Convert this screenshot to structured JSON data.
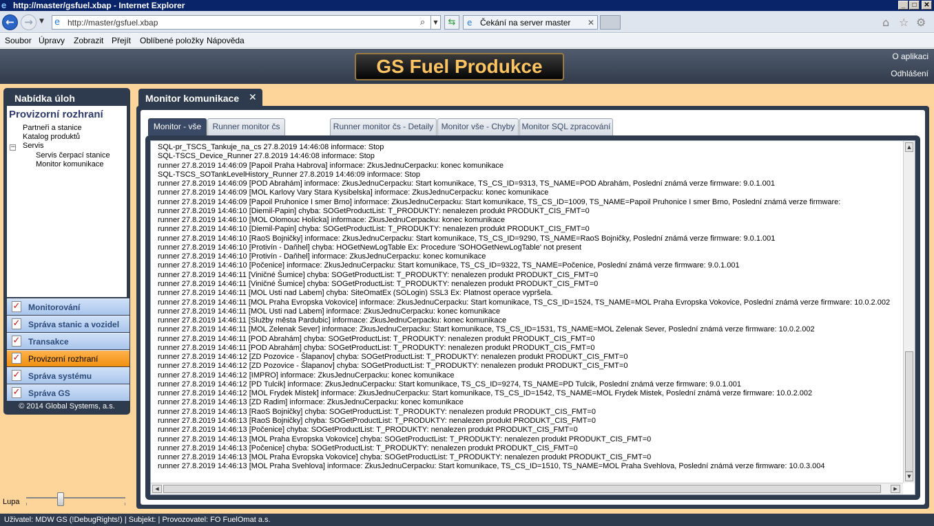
{
  "window": {
    "title": "http://master/gsfuel.xbap - Internet Explorer",
    "minimize": "_",
    "maximize": "□",
    "close": "✕"
  },
  "browser": {
    "url": "http://master/gsfuel.xbap",
    "tab_title": "Čekání na server master"
  },
  "menu": [
    "Soubor",
    "Úpravy",
    "Zobrazit",
    "Přejít",
    "Oblíbené položky",
    "Nápověda"
  ],
  "app": {
    "title": "GS Fuel Produkce",
    "about_link": "O aplikaci",
    "logout_link": "Odhlášení"
  },
  "left_panel": {
    "title": "Nabídka úloh",
    "tree_title": "Provizorní rozhraní",
    "tree": {
      "item1": "Partneři a stanice",
      "item2": "Katalog produktů",
      "group": "Servis",
      "toggle": "−",
      "sub1": "Servis čerpací stanice",
      "sub2": "Monitor komunikace"
    },
    "nav": [
      {
        "label": "Monitorování"
      },
      {
        "label": "Správa stanic a vozidel"
      },
      {
        "label": "Transakce"
      },
      {
        "label": "Provizorní rozhraní"
      },
      {
        "label": "Správa systému"
      },
      {
        "label": "Správa GS"
      }
    ],
    "copyright": "© 2014 Global Systems, a.s.",
    "zoom_label": "Lupa"
  },
  "main": {
    "tab_title": "Monitor komunikace",
    "tab_close": "✕",
    "subtabs": [
      "Monitor - vše",
      "Runner monitor čs",
      "Runner monitor čs - Detaily",
      "Monitor vše - Chyby",
      "Monitor SQL zpracování"
    ],
    "log": [
      "SQL-pr_TSCS_Tankuje_na_cs 27.8.2019 14:46:08 informace: Stop",
      "SQL-TSCS_Device_Runner 27.8.2019 14:46:08 informace: Stop",
      "runner 27.8.2019 14:46:09 [Papoil Praha Habrova] informace: ZkusJednuCerpacku: konec komunikace",
      "SQL-TSCS_SOTankLevelHistory_Runner 27.8.2019 14:46:09 informace: Stop",
      "runner 27.8.2019 14:46:09 [POD Abrahám] informace: ZkusJednuCerpacku: Start komunikace, TS_CS_ID=9313, TS_NAME=POD Abrahám, Poslední známá verze firmware: 9.0.1.001",
      "runner 27.8.2019 14:46:09 [MOL Karlovy Vary Stara Kysibelska] informace: ZkusJednuCerpacku: konec komunikace",
      "runner 27.8.2019 14:46:09 [Papoil Pruhonice I smer Brno] informace: ZkusJednuCerpacku: Start komunikace, TS_CS_ID=1009, TS_NAME=Papoil Pruhonice I smer Brno, Poslední známá verze firmware:",
      "runner 27.8.2019 14:46:10 [Diemil-Papin] chyba: SOGetProductList: T_PRODUKTY: nenalezen produkt PRODUKT_CIS_FMT=0",
      "runner 27.8.2019 14:46:10 [MOL Olomouc Holicka] informace: ZkusJednuCerpacku: konec komunikace",
      "runner 27.8.2019 14:46:10 [Diemil-Papin] chyba: SOGetProductList: T_PRODUKTY: nenalezen produkt PRODUKT_CIS_FMT=0",
      "runner 27.8.2019 14:46:10 [RaoS Bojničky] informace: ZkusJednuCerpacku: Start komunikace, TS_CS_ID=9290, TS_NAME=RaoS Bojničky, Poslední známá verze firmware: 9.0.1.001",
      "runner 27.8.2019 14:46:10 [Protivín - Daňhel] chyba: HOGetNewLogTable Ex: Procedure 'SOHOGetNewLogTable' not present",
      "runner 27.8.2019 14:46:10 [Protivín - Daňhel] informace: ZkusJednuCerpacku: konec komunikace",
      "runner 27.8.2019 14:46:10 [Počenice] informace: ZkusJednuCerpacku: Start komunikace, TS_CS_ID=9322, TS_NAME=Počenice, Poslední známá verze firmware: 9.0.1.001",
      "runner 27.8.2019 14:46:11 [Viničné Šumice] chyba: SOGetProductList: T_PRODUKTY: nenalezen produkt PRODUKT_CIS_FMT=0",
      "runner 27.8.2019 14:46:11 [Viničné Šumice] chyba: SOGetProductList: T_PRODUKTY: nenalezen produkt PRODUKT_CIS_FMT=0",
      "runner 27.8.2019 14:46:11 [MOL Usti nad Labem] chyba: SiteOmatEx (SOLogin) SSL3 Ex: Platnost operace vypršela.",
      "runner 27.8.2019 14:46:11 [MOL Praha Evropska Vokovice] informace: ZkusJednuCerpacku: Start komunikace, TS_CS_ID=1524, TS_NAME=MOL Praha Evropska Vokovice, Poslední známá verze firmware: 10.0.2.002",
      "runner 27.8.2019 14:46:11 [MOL Usti nad Labem] informace: ZkusJednuCerpacku: konec komunikace",
      "runner 27.8.2019 14:46:11 [Služby města Pardubic] informace: ZkusJednuCerpacku: konec komunikace",
      "runner 27.8.2019 14:46:11 [MOL Zelenak Sever] informace: ZkusJednuCerpacku: Start komunikace, TS_CS_ID=1531, TS_NAME=MOL Zelenak Sever, Poslední známá verze firmware: 10.0.2.002",
      "runner 27.8.2019 14:46:11 [POD Abrahám] chyba: SOGetProductList: T_PRODUKTY: nenalezen produkt PRODUKT_CIS_FMT=0",
      "runner 27.8.2019 14:46:11 [POD Abrahám] chyba: SOGetProductList: T_PRODUKTY: nenalezen produkt PRODUKT_CIS_FMT=0",
      "runner 27.8.2019 14:46:12 [ZD Pozovice - Šlapanov] chyba: SOGetProductList: T_PRODUKTY: nenalezen produkt PRODUKT_CIS_FMT=0",
      "runner 27.8.2019 14:46:12 [ZD Pozovice - Šlapanov] chyba: SOGetProductList: T_PRODUKTY: nenalezen produkt PRODUKT_CIS_FMT=0",
      "runner 27.8.2019 14:46:12 [IMPRO] informace: ZkusJednuCerpacku: konec komunikace",
      "runner 27.8.2019 14:46:12 [PD Tulcik] informace: ZkusJednuCerpacku: Start komunikace, TS_CS_ID=9274, TS_NAME=PD Tulcik, Poslední známá verze firmware: 9.0.1.001",
      "runner 27.8.2019 14:46:12 [MOL Frydek Mistek] informace: ZkusJednuCerpacku: Start komunikace, TS_CS_ID=1542, TS_NAME=MOL Frydek Mistek, Poslední známá verze firmware: 10.0.2.002",
      "runner 27.8.2019 14:46:13 [ZD Radim] informace: ZkusJednuCerpacku: konec komunikace",
      "runner 27.8.2019 14:46:13 [RaoS Bojničky] chyba: SOGetProductList: T_PRODUKTY: nenalezen produkt PRODUKT_CIS_FMT=0",
      "runner 27.8.2019 14:46:13 [RaoS Bojničky] chyba: SOGetProductList: T_PRODUKTY: nenalezen produkt PRODUKT_CIS_FMT=0",
      "runner 27.8.2019 14:46:13 [Počenice] chyba: SOGetProductList: T_PRODUKTY: nenalezen produkt PRODUKT_CIS_FMT=0",
      "runner 27.8.2019 14:46:13 [MOL Praha Evropska Vokovice] chyba: SOGetProductList: T_PRODUKTY: nenalezen produkt PRODUKT_CIS_FMT=0",
      "runner 27.8.2019 14:46:13 [Počenice] chyba: SOGetProductList: T_PRODUKTY: nenalezen produkt PRODUKT_CIS_FMT=0",
      "runner 27.8.2019 14:46:13 [MOL Praha Evropska Vokovice] chyba: SOGetProductList: T_PRODUKTY: nenalezen produkt PRODUKT_CIS_FMT=0",
      "runner 27.8.2019 14:46:13 [MOL Praha Svehlova] informace: ZkusJednuCerpacku: Start komunikace, TS_CS_ID=1510, TS_NAME=MOL Praha Svehlova, Poslední známá verze firmware: 10.0.3.004"
    ]
  },
  "status": "Uživatel: MDW GS (!DebugRights!) | Subjekt:   | Provozovatel: FO FuelOmat a.s.",
  "icons": {
    "ie": "ie-logo-icon",
    "back": "back-arrow-icon",
    "forward": "forward-arrow-icon",
    "search": "search-icon",
    "refresh": "refresh-icon",
    "home": "home-icon",
    "favorites": "star-icon",
    "tools": "gear-icon",
    "checklist": "checklist-icon"
  },
  "colors": {
    "app_background": "#fdd49a",
    "panel_dark": "#2e3a4d",
    "brand_text": "#fcc463",
    "nav_active": "#f0900f",
    "nav_inactive": "#a9c5ec"
  }
}
